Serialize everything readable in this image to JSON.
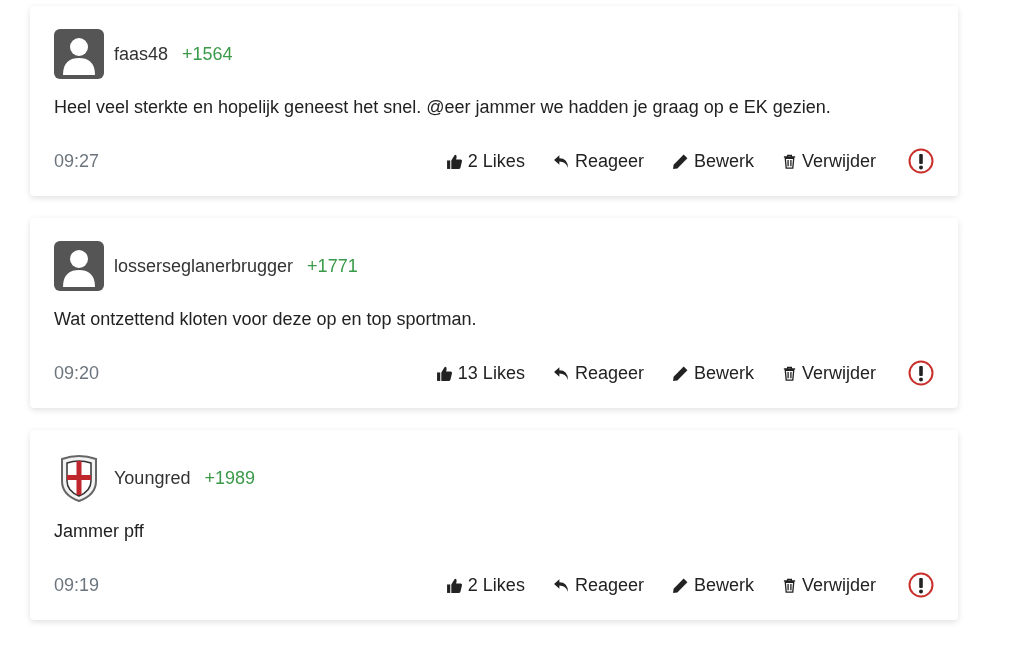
{
  "comments": [
    {
      "avatar": {
        "kind": "default"
      },
      "username": "faas48",
      "score": "+1564",
      "text": "Heel veel sterkte en hopelijk geneest het snel. @eer jammer we hadden je graag op e EK gezien.",
      "time": "09:27",
      "likes": "2 Likes",
      "reply": "Reageer",
      "edit": "Bewerk",
      "delete": "Verwijder"
    },
    {
      "avatar": {
        "kind": "default"
      },
      "username": "losserseglanerbrugger",
      "score": "+1771",
      "text": "Wat ontzettend kloten voor deze op en top sportman.",
      "time": "09:20",
      "likes": "13 Likes",
      "reply": "Reageer",
      "edit": "Bewerk",
      "delete": "Verwijder"
    },
    {
      "avatar": {
        "kind": "crest"
      },
      "username": "Youngred",
      "score": "+1989",
      "text": "Jammer pff",
      "time": "09:19",
      "likes": "2 Likes",
      "reply": "Reageer",
      "edit": "Bewerk",
      "delete": "Verwijder"
    }
  ]
}
